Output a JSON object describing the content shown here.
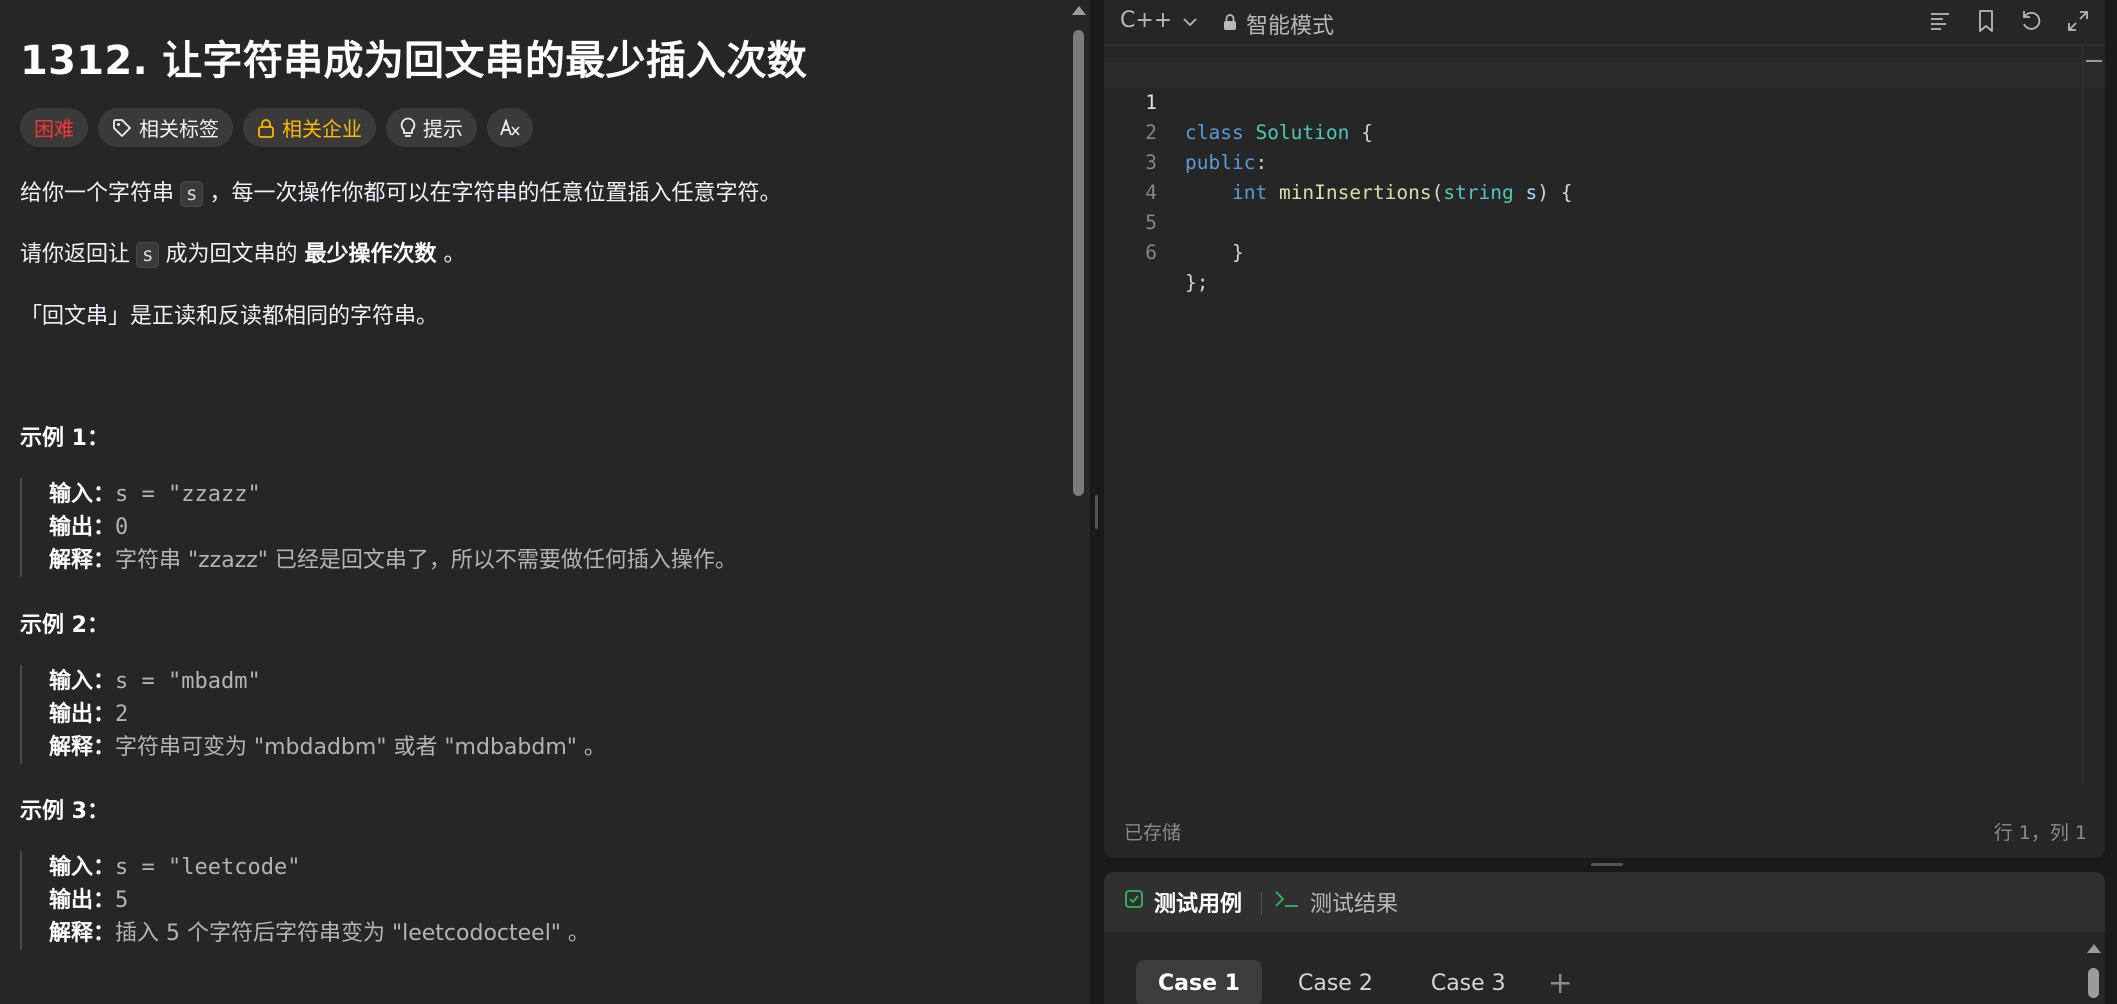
{
  "problem": {
    "title": "1312. 让字符串成为回文串的最少插入次数",
    "tags": {
      "difficulty": "困难",
      "related_tags": "相关标签",
      "related_companies": "相关企业",
      "hint": "提示"
    },
    "desc_line1_a": "给你一个字符串",
    "desc_line1_code": "s",
    "desc_line1_b": "，每一次操作你都可以在字符串的任意位置插入任意字符。",
    "desc_line2_a": "请你返回让",
    "desc_line2_code": "s",
    "desc_line2_b": "成为回文串的",
    "desc_line2_strong": "最少操作次数",
    "desc_line2_c": "。",
    "desc_line3": "「回文串」是正读和反读都相同的字符串。",
    "examples": [
      {
        "title": "示例 1：",
        "input_label": "输入：",
        "input": "s = \"zzazz\"",
        "output_label": "输出：",
        "output": "0",
        "explain_label": "解释：",
        "explain": "字符串 \"zzazz\" 已经是回文串了，所以不需要做任何插入操作。"
      },
      {
        "title": "示例 2：",
        "input_label": "输入：",
        "input": "s = \"mbadm\"",
        "output_label": "输出：",
        "output": "2",
        "explain_label": "解释：",
        "explain": "字符串可变为 \"mbdadbm\" 或者 \"mdbabdm\" 。"
      },
      {
        "title": "示例 3：",
        "input_label": "输入：",
        "input": "s = \"leetcode\"",
        "output_label": "输出：",
        "output": "5",
        "explain_label": "解释：",
        "explain": "插入 5 个字符后字符串变为 \"leetcodocteel\" 。"
      }
    ]
  },
  "editor": {
    "language": "C++",
    "mode": "智能模式",
    "line_numbers": [
      "1",
      "2",
      "3",
      "4",
      "5",
      "6"
    ],
    "saved_status": "已存储",
    "cursor_position": "行 1，列 1",
    "icons": [
      "format-icon",
      "bookmark-icon",
      "undo-icon",
      "fullscreen-icon"
    ]
  },
  "tests": {
    "tab_cases": "测试用例",
    "tab_result": "测试结果",
    "cases": [
      "Case 1",
      "Case 2",
      "Case 3"
    ],
    "add_case": "+"
  },
  "colors": {
    "keyword": "#569cd6",
    "type": "#4ec9b0",
    "function": "#dcdcaa",
    "param": "#9cdcfe",
    "hard": "#f63636",
    "company": "#ffb800",
    "check_green": "#2cbb5d"
  }
}
